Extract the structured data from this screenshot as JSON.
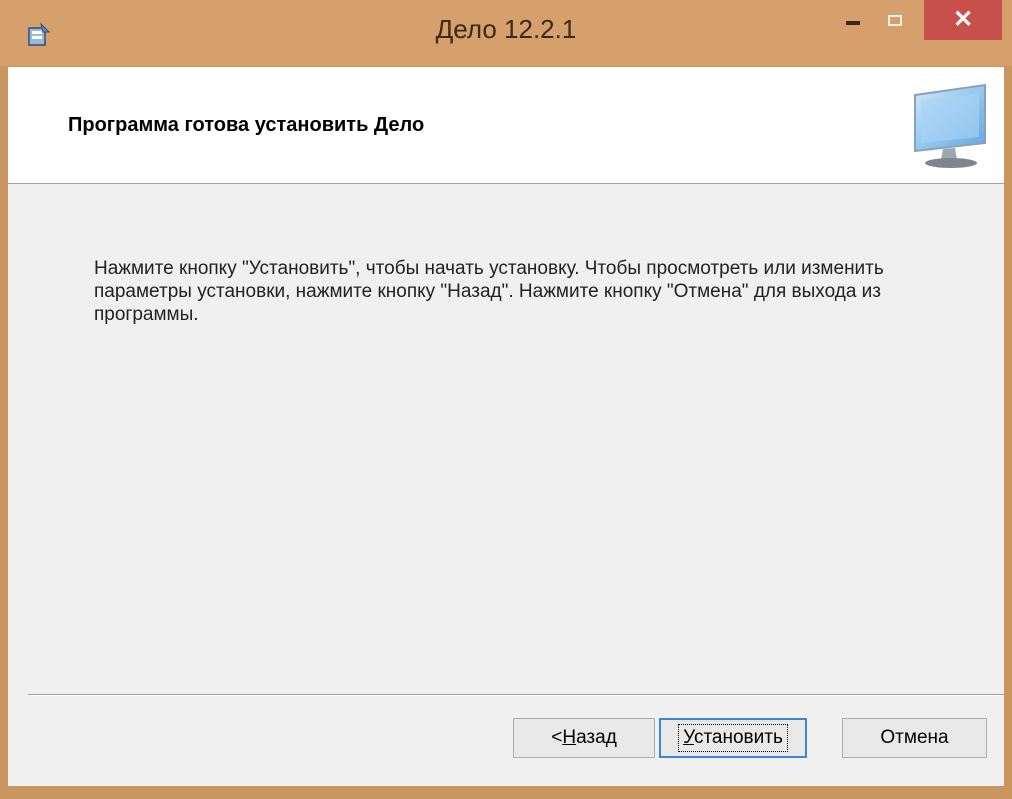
{
  "window": {
    "title": "Дело 12.2.1",
    "colors": {
      "frame": "#d5a06b",
      "close_button": "#c7504a",
      "focus": "#3a85d6"
    }
  },
  "header": {
    "title": "Программа готова установить Дело",
    "icon": "monitor-icon"
  },
  "body": {
    "text": "Нажмите кнопку \"Установить\", чтобы начать установку. Чтобы просмотреть или изменить параметры установки, нажмите кнопку \"Назад\". Нажмите кнопку \"Отмена\" для выхода из программы."
  },
  "buttons": {
    "back": {
      "prefix": "< ",
      "mnemonic": "Н",
      "rest": "азад"
    },
    "install": {
      "mnemonic": "У",
      "rest": "становить"
    },
    "cancel": {
      "label": "Отмена"
    }
  }
}
